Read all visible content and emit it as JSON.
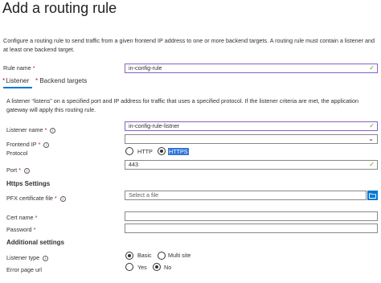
{
  "page": {
    "title": "Add a routing rule",
    "description": "Configure a routing rule to send traffic from a given frontend IP address to one or more backend targets. A routing rule must contain a listener and at least one backend target."
  },
  "rule_name": {
    "label": "Rule name",
    "value": "in-config-rule"
  },
  "tabs": [
    {
      "label": "Listener",
      "active": true
    },
    {
      "label": "Backend targets",
      "active": false
    }
  ],
  "listener": {
    "description": "A listener “listens” on a specified port and IP address for traffic that uses a specified protocol. If the listener criteria are met, the application gateway will apply this routing rule.",
    "name_label": "Listener name",
    "name_value": "in-config-rule-listner",
    "frontend_ip_label": "Frontend IP",
    "frontend_ip_value": "",
    "protocol_label": "Protocol",
    "protocol_options": [
      "HTTP",
      "HTTPS"
    ],
    "protocol_selected": "HTTPS",
    "port_label": "Port",
    "port_value": "443"
  },
  "https_settings": {
    "heading": "Https Settings",
    "pfx_label": "PFX certificate file",
    "pfx_placeholder": "Select a file",
    "cert_name_label": "Cert name",
    "password_label": "Password"
  },
  "additional_settings": {
    "heading": "Additional settings",
    "listener_type_label": "Listener type",
    "listener_type_options": [
      "Basic",
      "Multi site"
    ],
    "listener_type_selected": "Basic",
    "error_page_label": "Error page url",
    "error_page_options": [
      "Yes",
      "No"
    ],
    "error_page_selected": "No"
  },
  "colors": {
    "accent": "#0078d4",
    "valid_check": "#57a300",
    "required": "#a4262c",
    "focus_border": "#8661c5"
  }
}
